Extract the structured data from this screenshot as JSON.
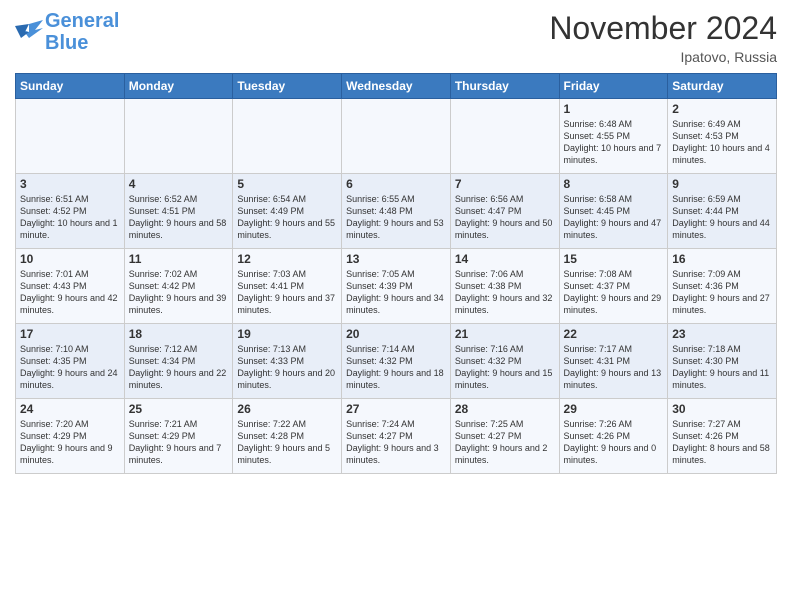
{
  "header": {
    "logo_line1": "General",
    "logo_line2": "Blue",
    "month": "November 2024",
    "location": "Ipatovo, Russia"
  },
  "weekdays": [
    "Sunday",
    "Monday",
    "Tuesday",
    "Wednesday",
    "Thursday",
    "Friday",
    "Saturday"
  ],
  "weeks": [
    [
      {
        "day": "",
        "info": ""
      },
      {
        "day": "",
        "info": ""
      },
      {
        "day": "",
        "info": ""
      },
      {
        "day": "",
        "info": ""
      },
      {
        "day": "",
        "info": ""
      },
      {
        "day": "1",
        "info": "Sunrise: 6:48 AM\nSunset: 4:55 PM\nDaylight: 10 hours and 7 minutes."
      },
      {
        "day": "2",
        "info": "Sunrise: 6:49 AM\nSunset: 4:53 PM\nDaylight: 10 hours and 4 minutes."
      }
    ],
    [
      {
        "day": "3",
        "info": "Sunrise: 6:51 AM\nSunset: 4:52 PM\nDaylight: 10 hours and 1 minute."
      },
      {
        "day": "4",
        "info": "Sunrise: 6:52 AM\nSunset: 4:51 PM\nDaylight: 9 hours and 58 minutes."
      },
      {
        "day": "5",
        "info": "Sunrise: 6:54 AM\nSunset: 4:49 PM\nDaylight: 9 hours and 55 minutes."
      },
      {
        "day": "6",
        "info": "Sunrise: 6:55 AM\nSunset: 4:48 PM\nDaylight: 9 hours and 53 minutes."
      },
      {
        "day": "7",
        "info": "Sunrise: 6:56 AM\nSunset: 4:47 PM\nDaylight: 9 hours and 50 minutes."
      },
      {
        "day": "8",
        "info": "Sunrise: 6:58 AM\nSunset: 4:45 PM\nDaylight: 9 hours and 47 minutes."
      },
      {
        "day": "9",
        "info": "Sunrise: 6:59 AM\nSunset: 4:44 PM\nDaylight: 9 hours and 44 minutes."
      }
    ],
    [
      {
        "day": "10",
        "info": "Sunrise: 7:01 AM\nSunset: 4:43 PM\nDaylight: 9 hours and 42 minutes."
      },
      {
        "day": "11",
        "info": "Sunrise: 7:02 AM\nSunset: 4:42 PM\nDaylight: 9 hours and 39 minutes."
      },
      {
        "day": "12",
        "info": "Sunrise: 7:03 AM\nSunset: 4:41 PM\nDaylight: 9 hours and 37 minutes."
      },
      {
        "day": "13",
        "info": "Sunrise: 7:05 AM\nSunset: 4:39 PM\nDaylight: 9 hours and 34 minutes."
      },
      {
        "day": "14",
        "info": "Sunrise: 7:06 AM\nSunset: 4:38 PM\nDaylight: 9 hours and 32 minutes."
      },
      {
        "day": "15",
        "info": "Sunrise: 7:08 AM\nSunset: 4:37 PM\nDaylight: 9 hours and 29 minutes."
      },
      {
        "day": "16",
        "info": "Sunrise: 7:09 AM\nSunset: 4:36 PM\nDaylight: 9 hours and 27 minutes."
      }
    ],
    [
      {
        "day": "17",
        "info": "Sunrise: 7:10 AM\nSunset: 4:35 PM\nDaylight: 9 hours and 24 minutes."
      },
      {
        "day": "18",
        "info": "Sunrise: 7:12 AM\nSunset: 4:34 PM\nDaylight: 9 hours and 22 minutes."
      },
      {
        "day": "19",
        "info": "Sunrise: 7:13 AM\nSunset: 4:33 PM\nDaylight: 9 hours and 20 minutes."
      },
      {
        "day": "20",
        "info": "Sunrise: 7:14 AM\nSunset: 4:32 PM\nDaylight: 9 hours and 18 minutes."
      },
      {
        "day": "21",
        "info": "Sunrise: 7:16 AM\nSunset: 4:32 PM\nDaylight: 9 hours and 15 minutes."
      },
      {
        "day": "22",
        "info": "Sunrise: 7:17 AM\nSunset: 4:31 PM\nDaylight: 9 hours and 13 minutes."
      },
      {
        "day": "23",
        "info": "Sunrise: 7:18 AM\nSunset: 4:30 PM\nDaylight: 9 hours and 11 minutes."
      }
    ],
    [
      {
        "day": "24",
        "info": "Sunrise: 7:20 AM\nSunset: 4:29 PM\nDaylight: 9 hours and 9 minutes."
      },
      {
        "day": "25",
        "info": "Sunrise: 7:21 AM\nSunset: 4:29 PM\nDaylight: 9 hours and 7 minutes."
      },
      {
        "day": "26",
        "info": "Sunrise: 7:22 AM\nSunset: 4:28 PM\nDaylight: 9 hours and 5 minutes."
      },
      {
        "day": "27",
        "info": "Sunrise: 7:24 AM\nSunset: 4:27 PM\nDaylight: 9 hours and 3 minutes."
      },
      {
        "day": "28",
        "info": "Sunrise: 7:25 AM\nSunset: 4:27 PM\nDaylight: 9 hours and 2 minutes."
      },
      {
        "day": "29",
        "info": "Sunrise: 7:26 AM\nSunset: 4:26 PM\nDaylight: 9 hours and 0 minutes."
      },
      {
        "day": "30",
        "info": "Sunrise: 7:27 AM\nSunset: 4:26 PM\nDaylight: 8 hours and 58 minutes."
      }
    ]
  ]
}
